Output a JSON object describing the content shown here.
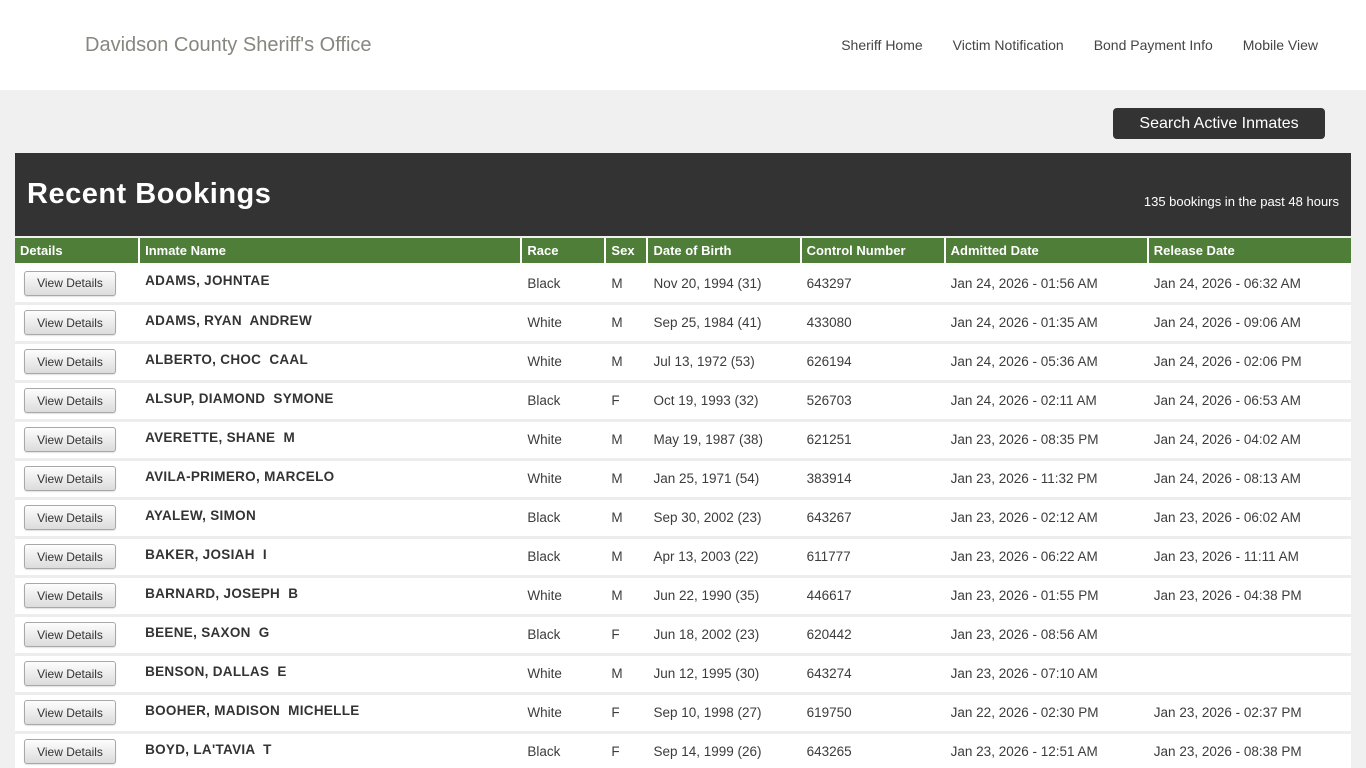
{
  "header": {
    "title": "Davidson County Sheriff's Office",
    "nav": [
      {
        "label": "Sheriff Home"
      },
      {
        "label": "Victim Notification"
      },
      {
        "label": "Bond Payment Info"
      },
      {
        "label": "Mobile View"
      }
    ]
  },
  "toolbar": {
    "search_button_label": "Search Active Inmates"
  },
  "bookings": {
    "title": "Recent Bookings",
    "subtitle": "135 bookings in the past 48 hours",
    "view_details_label": "View Details",
    "columns": [
      "Details",
      "Inmate Name",
      "Race",
      "Sex",
      "Date of Birth",
      "Control Number",
      "Admitted Date",
      "Release Date"
    ],
    "rows": [
      {
        "name": "ADAMS, JOHNTAE",
        "race": "Black",
        "sex": "M",
        "dob": "Nov 20, 1994 (31)",
        "control": "643297",
        "admitted": "Jan 24, 2026 - 01:56 AM",
        "released": "Jan 24, 2026 - 06:32 AM"
      },
      {
        "name": "ADAMS, RYAN  ANDREW",
        "race": "White",
        "sex": "M",
        "dob": "Sep 25, 1984 (41)",
        "control": "433080",
        "admitted": "Jan 24, 2026 - 01:35 AM",
        "released": "Jan 24, 2026 - 09:06 AM"
      },
      {
        "name": "ALBERTO, CHOC  CAAL",
        "race": "White",
        "sex": "M",
        "dob": "Jul 13, 1972 (53)",
        "control": "626194",
        "admitted": "Jan 24, 2026 - 05:36 AM",
        "released": "Jan 24, 2026 - 02:06 PM"
      },
      {
        "name": "ALSUP, DIAMOND  SYMONE",
        "race": "Black",
        "sex": "F",
        "dob": "Oct 19, 1993 (32)",
        "control": "526703",
        "admitted": "Jan 24, 2026 - 02:11 AM",
        "released": "Jan 24, 2026 - 06:53 AM"
      },
      {
        "name": "AVERETTE, SHANE  M",
        "race": "White",
        "sex": "M",
        "dob": "May 19, 1987 (38)",
        "control": "621251",
        "admitted": "Jan 23, 2026 - 08:35 PM",
        "released": "Jan 24, 2026 - 04:02 AM"
      },
      {
        "name": "AVILA-PRIMERO, MARCELO",
        "race": "White",
        "sex": "M",
        "dob": "Jan 25, 1971 (54)",
        "control": "383914",
        "admitted": "Jan 23, 2026 - 11:32 PM",
        "released": "Jan 24, 2026 - 08:13 AM"
      },
      {
        "name": "AYALEW, SIMON",
        "race": "Black",
        "sex": "M",
        "dob": "Sep 30, 2002 (23)",
        "control": "643267",
        "admitted": "Jan 23, 2026 - 02:12 AM",
        "released": "Jan 23, 2026 - 06:02 AM"
      },
      {
        "name": "BAKER, JOSIAH  I",
        "race": "Black",
        "sex": "M",
        "dob": "Apr 13, 2003 (22)",
        "control": "611777",
        "admitted": "Jan 23, 2026 - 06:22 AM",
        "released": "Jan 23, 2026 - 11:11 AM"
      },
      {
        "name": "BARNARD, JOSEPH  B",
        "race": "White",
        "sex": "M",
        "dob": "Jun 22, 1990 (35)",
        "control": "446617",
        "admitted": "Jan 23, 2026 - 01:55 PM",
        "released": "Jan 23, 2026 - 04:38 PM"
      },
      {
        "name": "BEENE, SAXON  G",
        "race": "Black",
        "sex": "F",
        "dob": "Jun 18, 2002 (23)",
        "control": "620442",
        "admitted": "Jan 23, 2026 - 08:56 AM",
        "released": ""
      },
      {
        "name": "BENSON, DALLAS  E",
        "race": "White",
        "sex": "M",
        "dob": "Jun 12, 1995 (30)",
        "control": "643274",
        "admitted": "Jan 23, 2026 - 07:10 AM",
        "released": ""
      },
      {
        "name": "BOOHER, MADISON  MICHELLE",
        "race": "White",
        "sex": "F",
        "dob": "Sep 10, 1998 (27)",
        "control": "619750",
        "admitted": "Jan 22, 2026 - 02:30 PM",
        "released": "Jan 23, 2026 - 02:37 PM"
      },
      {
        "name": "BOYD, LA'TAVIA  T",
        "race": "Black",
        "sex": "F",
        "dob": "Sep 14, 1999 (26)",
        "control": "643265",
        "admitted": "Jan 23, 2026 - 12:51 AM",
        "released": "Jan 23, 2026 - 08:38 PM"
      }
    ]
  },
  "colors": {
    "accent_green": "#4e7e38",
    "banner_dark": "#333333",
    "page_background": "#f0f0f0"
  }
}
